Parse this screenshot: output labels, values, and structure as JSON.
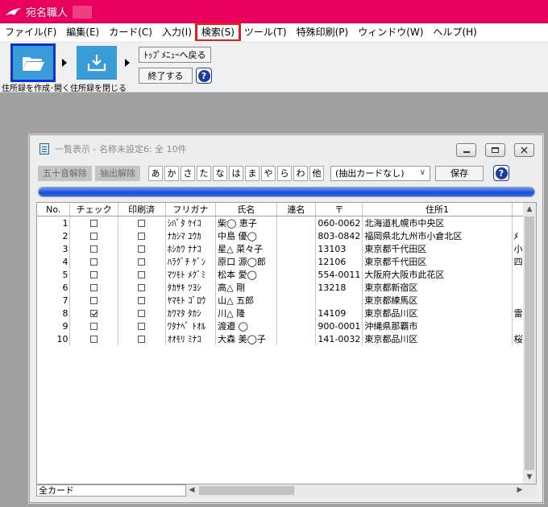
{
  "app": {
    "title": "宛名職人"
  },
  "menu": [
    {
      "label": "ファイル(F)"
    },
    {
      "label": "編集(E)"
    },
    {
      "label": "カード(C)"
    },
    {
      "label": "入力(I)"
    },
    {
      "label": "検索(S)"
    },
    {
      "label": "ツール(T)"
    },
    {
      "label": "特殊印刷(P)"
    },
    {
      "label": "ウィンドウ(W)"
    },
    {
      "label": "ヘルプ(H)"
    }
  ],
  "toolbar": {
    "create_caption": "住所録を作成･開く",
    "close_caption": "住所録を閉じる",
    "top_menu_label": "ﾄｯﾌﾟﾒﾆｭｰへ戻る",
    "exit_label": "終了する",
    "help_label": "?"
  },
  "list_window": {
    "title": "一覧表示 - 名称未設定6: 全 10件",
    "btn_gojuon_clear": "五十音解除",
    "btn_extract_clear": "抽出解除",
    "kana_buttons": [
      "あ",
      "か",
      "さ",
      "た",
      "な",
      "は",
      "ま",
      "や",
      "ら",
      "わ",
      "他"
    ],
    "filter_value": "(抽出カードなし)",
    "save_label": "保存",
    "help_label": "?",
    "progress": 1.0,
    "columns": [
      "No.",
      "チェック",
      "印刷済",
      "フリガナ",
      "氏名",
      "連名",
      "〒",
      "住所1"
    ],
    "rows": [
      {
        "no": "1",
        "checked": false,
        "printed": false,
        "furigana": "ｼﾊﾞﾀ ｹｲｺ",
        "name": "柴◯ 恵子",
        "renmei": "",
        "zip": "060-0062",
        "addr1": "北海道札幌市中央区",
        "addr2": ""
      },
      {
        "no": "2",
        "checked": false,
        "printed": false,
        "furigana": "ﾅｶｼﾏ ﾕｳｶ",
        "name": "中島 優◯",
        "renmei": "",
        "zip": "803-0842",
        "addr1": "福岡県北九州市小倉北区",
        "addr2": "ﾒ"
      },
      {
        "no": "3",
        "checked": false,
        "printed": false,
        "furigana": "ﾎｼｶﾜ ﾅﾅｺ",
        "name": "星△ 菜々子",
        "renmei": "",
        "zip": "13103",
        "addr1": "東京都千代田区",
        "addr2": "小"
      },
      {
        "no": "4",
        "checked": false,
        "printed": false,
        "furigana": "ﾊﾗｸﾞﾁ ｹﾞﾝ",
        "name": "原口 源◯郎",
        "renmei": "",
        "zip": "12106",
        "addr1": "東京都千代田区",
        "addr2": "四"
      },
      {
        "no": "5",
        "checked": false,
        "printed": false,
        "furigana": "ﾏﾂﾓﾄ ﾒｸﾞﾐ",
        "name": "松本 愛◯",
        "renmei": "",
        "zip": "554-0011",
        "addr1": "大阪府大阪市此花区",
        "addr2": ""
      },
      {
        "no": "6",
        "checked": false,
        "printed": false,
        "furigana": "ﾀｶｻｷ ﾂﾖｼ",
        "name": "高△ 剛",
        "renmei": "",
        "zip": "13218",
        "addr1": "東京都新宿区",
        "addr2": ""
      },
      {
        "no": "7",
        "checked": false,
        "printed": false,
        "furigana": "ﾔﾏﾓﾄ ｺﾞﾛｳ",
        "name": "山△ 五郎",
        "renmei": "",
        "zip": "",
        "addr1": "東京都練馬区",
        "addr2": ""
      },
      {
        "no": "8",
        "checked": true,
        "printed": false,
        "furigana": "ｶﾜﾏﾀ ﾀｶｼ",
        "name": "川△ 隆",
        "renmei": "",
        "zip": "14109",
        "addr1": "東京都品川区",
        "addr2": "雷"
      },
      {
        "no": "9",
        "checked": false,
        "printed": false,
        "furigana": "ﾜﾀﾅﾍﾞ ﾄｵﾙ",
        "name": "渡邉 ◯",
        "renmei": "",
        "zip": "900-0001",
        "addr1": "沖縄県那覇市",
        "addr2": ""
      },
      {
        "no": "10",
        "checked": false,
        "printed": false,
        "furigana": "ｵｵﾓﾘ ﾐﾅｺ",
        "name": "大森 美◯子",
        "renmei": "",
        "zip": "141-0032",
        "addr1": "東京都品川区",
        "addr2": "桜"
      }
    ],
    "status_text": "全カード"
  },
  "colors": {
    "titlebar": "#e8005c",
    "accent_blue": "#3a9bd9",
    "highlight": "#e02020",
    "progress": "#1e4fd4"
  }
}
